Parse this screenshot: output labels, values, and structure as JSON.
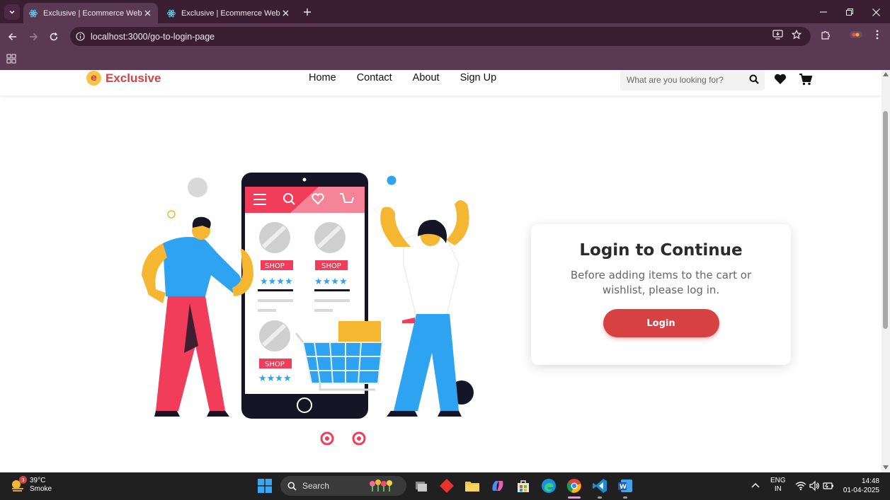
{
  "browser": {
    "tabs": [
      {
        "title": "Exclusive | Ecommerce Website",
        "active": true
      },
      {
        "title": "Exclusive | Ecommerce Website",
        "active": false
      }
    ],
    "url": "localhost:3000/go-to-login-page"
  },
  "site": {
    "logo_mark": "e",
    "logo_text": "Exclusive",
    "nav": [
      "Home",
      "Contact",
      "About",
      "Sign Up"
    ],
    "search_placeholder": "What are you looking for?",
    "brand_color": "#d84141"
  },
  "card": {
    "title": "Login to Continue",
    "message": "Before adding items to the cart or wishlist, please log in.",
    "button": "Login"
  },
  "illustration": {
    "shop_label": "SHOP"
  },
  "taskbar": {
    "weather_badge": "3",
    "temperature": "39°C",
    "condition": "Smoke",
    "search_label": "Search",
    "lang_top": "ENG",
    "lang_bottom": "IN",
    "time": "14:48",
    "date": "01-04-2025"
  }
}
